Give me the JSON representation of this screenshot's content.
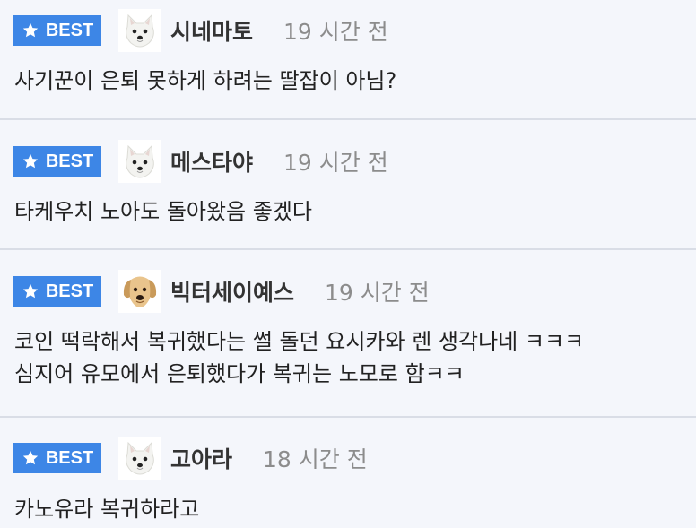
{
  "badge_label": "BEST",
  "accent_color": "#3d86e6",
  "comments": [
    {
      "nickname": "시네마토",
      "time": "19 시간 전",
      "avatar": "white-dog-avatar-icon",
      "lines": [
        "사기꾼이 은퇴 못하게 하려는 딸잡이 아님?"
      ]
    },
    {
      "nickname": "메스타야",
      "time": "19 시간 전",
      "avatar": "white-dog-avatar-icon",
      "lines": [
        "타케우치 노아도 돌아왔음 좋겠다"
      ]
    },
    {
      "nickname": "빅터세이예스",
      "time": "19 시간 전",
      "avatar": "golden-dog-avatar-icon",
      "lines": [
        "코인 떡락해서 복귀했다는 썰 돌던 요시카와 렌 생각나네 ㅋㅋㅋ",
        "심지어 유모에서 은퇴했다가 복귀는 노모로 함ㅋㅋ"
      ]
    },
    {
      "nickname": "고아라",
      "time": "18 시간 전",
      "avatar": "white-dog-avatar-icon",
      "lines": [
        "카노유라 복귀하라고"
      ]
    }
  ]
}
